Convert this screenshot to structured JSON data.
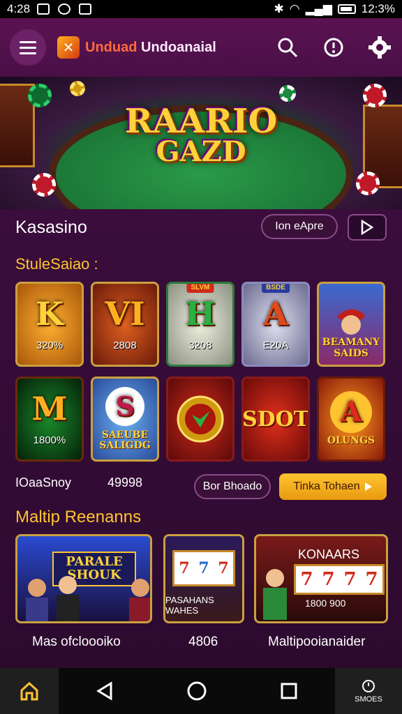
{
  "status_bar": {
    "time": "4:28",
    "battery": "12:3%"
  },
  "header": {
    "title_part1": "Unduad",
    "title_part2": "Undoanaial",
    "icons": [
      "menu-icon",
      "search-icon",
      "info-icon",
      "gear-icon"
    ]
  },
  "hero": {
    "line1": "RAARIO",
    "line2": "GAZD"
  },
  "section1": {
    "title": "Kasasino",
    "button_label": "Ion eApre"
  },
  "section2": {
    "title": "StuleSaiao :",
    "tiles_row1": [
      {
        "symbol": "K",
        "value": "320%"
      },
      {
        "symbol": "VI",
        "value": "2808"
      },
      {
        "symbol": "H",
        "value": "3208",
        "badge": "SLVM"
      },
      {
        "symbol": "A",
        "value": "E20A",
        "badge": "BSDE"
      },
      {
        "caption": "BEAMANY SAIDS"
      }
    ],
    "tiles_row2": [
      {
        "symbol": "M",
        "value": "1800%"
      },
      {
        "symbol": "S",
        "caption": "SAEUBE SALIGDG"
      },
      {
        "caption": ""
      },
      {
        "caption": "SDOT"
      },
      {
        "symbol": "A",
        "caption": "OLUNGS"
      }
    ],
    "footer_left": "IOaaSnoy",
    "footer_count": "49998",
    "footer_button": "Bor Bhoado",
    "footer_cta": "Tinka Tohaen"
  },
  "section3": {
    "title": "Maltip Reenanns",
    "cards": [
      {
        "art_text": "PARALE SHOUK",
        "label": "Mas ofcloooiko"
      },
      {
        "art_text": "PASAHANS WAHES",
        "label": "4806"
      },
      {
        "art_text": "KONAARS",
        "sub_text": "1800 900",
        "label": "Maltipooianaider"
      }
    ]
  },
  "nav": {
    "right_label": "SMOES"
  },
  "colors": {
    "accent": "#ffc430",
    "background": "#2a0a2c",
    "header": "#4a0f46"
  }
}
